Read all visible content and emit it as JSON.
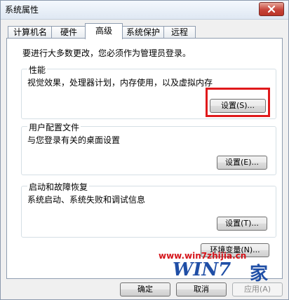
{
  "window": {
    "title": "系统属性",
    "close_icon": "close-x-icon"
  },
  "tabs": [
    {
      "label": "计算机名",
      "active": false
    },
    {
      "label": "硬件",
      "active": false
    },
    {
      "label": "高级",
      "active": true
    },
    {
      "label": "系统保护",
      "active": false
    },
    {
      "label": "远程",
      "active": false
    }
  ],
  "advanced": {
    "admin_notice": "要进行大多数更改，您必须作为管理员登录。",
    "performance": {
      "title": "性能",
      "description": "视觉效果，处理器计划，内存使用，以及虚拟内存",
      "button": "设置(S)..."
    },
    "user_profiles": {
      "title": "用户配置文件",
      "description": "与您登录有关的桌面设置",
      "button": "设置(E)..."
    },
    "startup_recovery": {
      "title": "启动和故障恢复",
      "description": "系统启动、系统失败和调试信息",
      "button": "设置(T)..."
    },
    "env_button": "环境变量(N)..."
  },
  "footer": {
    "ok": "确定",
    "cancel": "取消",
    "apply": "应用(A)"
  },
  "watermark": {
    "url": "www.win7zhijia.cn",
    "logo": "WIN7",
    "jia": "家",
    "color": "#d5141a"
  },
  "highlight_color": "#e0191b"
}
